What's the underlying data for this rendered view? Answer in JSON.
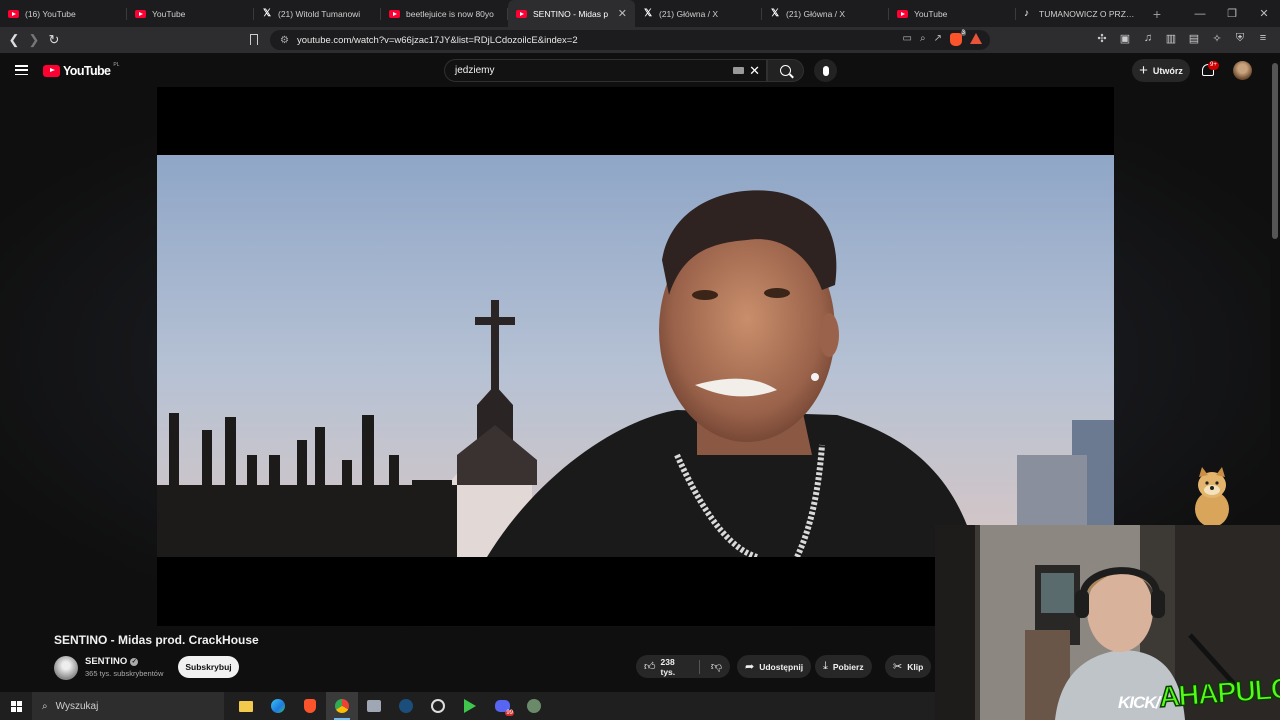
{
  "browser": {
    "tabs": [
      {
        "title": "(16) YouTube",
        "icon": "youtube-icon",
        "active": false
      },
      {
        "title": "YouTube",
        "icon": "youtube-icon",
        "active": false
      },
      {
        "title": "(21) Witold Tumanowi",
        "icon": "x-icon",
        "active": false
      },
      {
        "title": "beetlejuice is now 80yo",
        "icon": "youtube-icon",
        "active": false
      },
      {
        "title": "SENTINO - Midas p",
        "icon": "youtube-icon",
        "active": true
      },
      {
        "title": "(21) Główna / X",
        "icon": "x-icon",
        "active": false
      },
      {
        "title": "(21) Główna / X",
        "icon": "x-icon",
        "active": false
      },
      {
        "title": "YouTube",
        "icon": "youtube-icon",
        "active": false
      },
      {
        "title": "TUMANOWICZ O PRZESU",
        "icon": "tiktok-icon",
        "active": false
      }
    ],
    "url": "youtube.com/watch?v=w66jzac17JY&list=RDjLCdozoilcE&index=2",
    "brave_shield_count": "3"
  },
  "youtube": {
    "logo_text": "YouTube",
    "country_code": "PL",
    "search_value": "jedziemy",
    "create_label": "Utwórz",
    "notifications_badge": "9+"
  },
  "video": {
    "title": "SENTINO - Midas prod. CrackHouse",
    "channel_name": "SENTINO",
    "subscribers": "365 tys. subskrybentów",
    "subscribe_label": "Subskrybuj",
    "likes": "238 tys.",
    "share_label": "Udostępnij",
    "download_label": "Pobierz",
    "clip_label": "Klip"
  },
  "overlay": {
    "kick_label": "KICK/",
    "streamer_name": "AHAPULCO"
  },
  "taskbar": {
    "search_placeholder": "Wyszukaj",
    "apps": [
      "file-explorer-icon",
      "edge-icon",
      "brave-icon",
      "chrome-icon",
      "app-icon",
      "steam-icon",
      "obs-icon",
      "game-icon",
      "discord-icon",
      "app-icon"
    ],
    "discord_badge": "99"
  },
  "colors": {
    "youtube_red": "#ff0033",
    "kick_green": "#53fc18",
    "background": "#0f0f0f"
  }
}
